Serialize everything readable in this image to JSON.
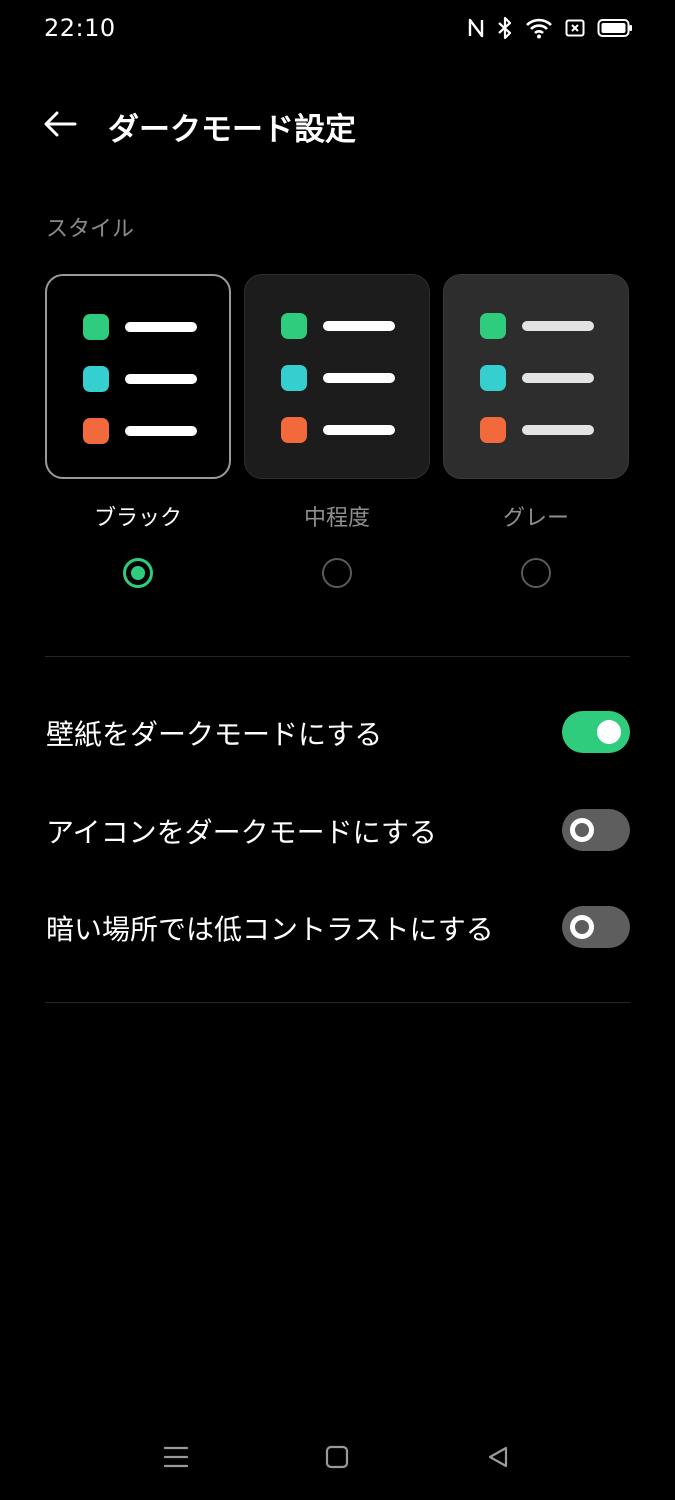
{
  "status_bar": {
    "time": "22:10",
    "icons": [
      "nfc-icon",
      "bluetooth-icon",
      "wifi-icon",
      "sim-off-icon",
      "battery-icon"
    ]
  },
  "header": {
    "back_icon": "arrow-left-icon",
    "title": "ダークモード設定"
  },
  "style_section": {
    "label": "スタイル",
    "options": [
      {
        "label": "ブラック",
        "selected": true
      },
      {
        "label": "中程度",
        "selected": false
      },
      {
        "label": "グレー",
        "selected": false
      }
    ],
    "preview_colors": [
      "#2fcc7d",
      "#35cfd0",
      "#f26a3c"
    ],
    "accent_color": "#2fcc7d"
  },
  "settings": [
    {
      "label": "壁紙をダークモードにする",
      "enabled": true
    },
    {
      "label": "アイコンをダークモードにする",
      "enabled": false
    },
    {
      "label": "暗い場所では低コントラストにする",
      "enabled": false
    }
  ],
  "nav_bar": {
    "buttons": [
      "menu-icon",
      "home-icon",
      "back-triangle-icon"
    ]
  }
}
